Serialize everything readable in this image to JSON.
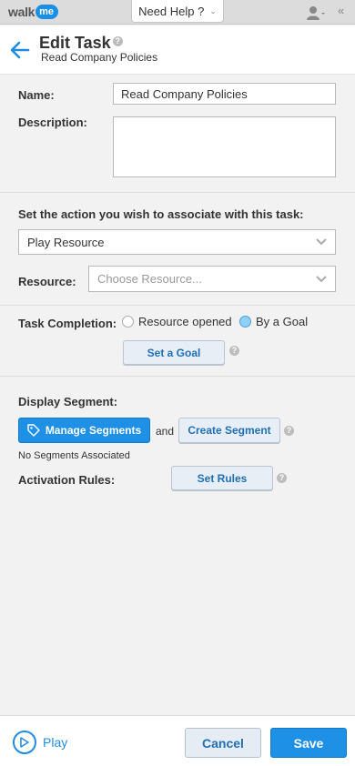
{
  "topbar": {
    "logo_walk": "walk",
    "logo_me": "me",
    "help_label": "Need Help ?",
    "user_icon": "user-icon",
    "collapse_icon": "double-chevron-left-icon"
  },
  "header": {
    "title": "Edit Task",
    "subtitle": "Read Company Policies",
    "back_icon": "arrow-left-icon",
    "help_icon": "question-icon"
  },
  "form": {
    "name_label": "Name:",
    "name_value": "Read Company Policies",
    "description_label": "Description:",
    "description_value": "",
    "action_label": "Set the action you wish to associate with this task:",
    "action_value": "Play Resource",
    "resource_label": "Resource:",
    "resource_placeholder": "Choose Resource...",
    "completion_label": "Task Completion:",
    "completion_options": [
      {
        "label": "Resource opened",
        "selected": false
      },
      {
        "label": "By a Goal",
        "selected": true
      }
    ],
    "set_goal_label": "Set a Goal",
    "display_segment_label": "Display Segment:",
    "manage_segments_label": "Manage Segments",
    "and_text": "and",
    "create_segment_label": "Create Segment",
    "no_segments_text": "No Segments Associated",
    "activation_rules_label": "Activation Rules:",
    "set_rules_label": "Set Rules"
  },
  "footer": {
    "play_label": "Play",
    "cancel_label": "Cancel",
    "save_label": "Save"
  },
  "colors": {
    "accent": "#1e90e6",
    "link": "#1f6fb5",
    "panel_bg": "#f2f2f2"
  }
}
